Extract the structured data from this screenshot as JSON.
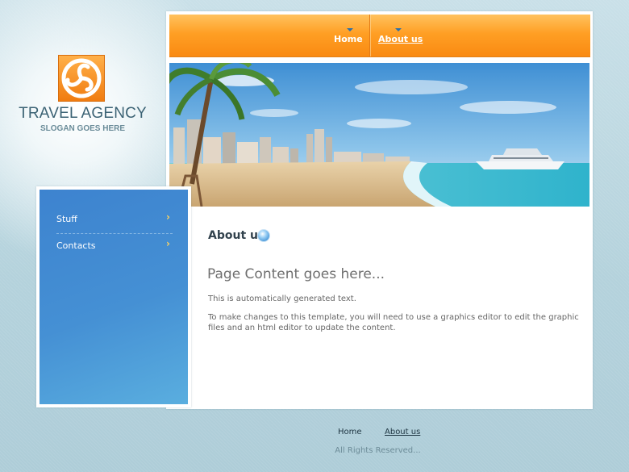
{
  "logo": {
    "title": "TRAVEL AGENCY",
    "slogan": "SLOGAN GOES HERE",
    "icon": "travel-agency-logo-icon"
  },
  "nav": {
    "items": [
      {
        "label": "Home",
        "current": false
      },
      {
        "label": "About us",
        "current": true
      }
    ]
  },
  "banner": {
    "subject": "beach-with-palm-tree-and-yacht"
  },
  "sidebar": {
    "items": [
      {
        "label": "Stuff",
        "icon": "chevron-right-icon"
      },
      {
        "label": "Contacts",
        "icon": "chevron-right-icon"
      }
    ]
  },
  "content": {
    "title": "About us",
    "heading": "Page Content goes here...",
    "paragraphs": [
      "This is automatically generated text.",
      "To make changes to this template, you will need to use a graphics editor to edit the graphic files and an html editor to update the content."
    ]
  },
  "footer": {
    "links": [
      {
        "label": "Home",
        "current": false
      },
      {
        "label": "About us",
        "current": true
      }
    ],
    "copyright": "All Rights Reserved..."
  },
  "colors": {
    "accent_orange": "#ff9f24",
    "sidebar_blue": "#4590d4",
    "nav_arrow": "#2c6fa8",
    "chevron_yellow": "#ffd45e",
    "background": "#b4d2dc"
  }
}
